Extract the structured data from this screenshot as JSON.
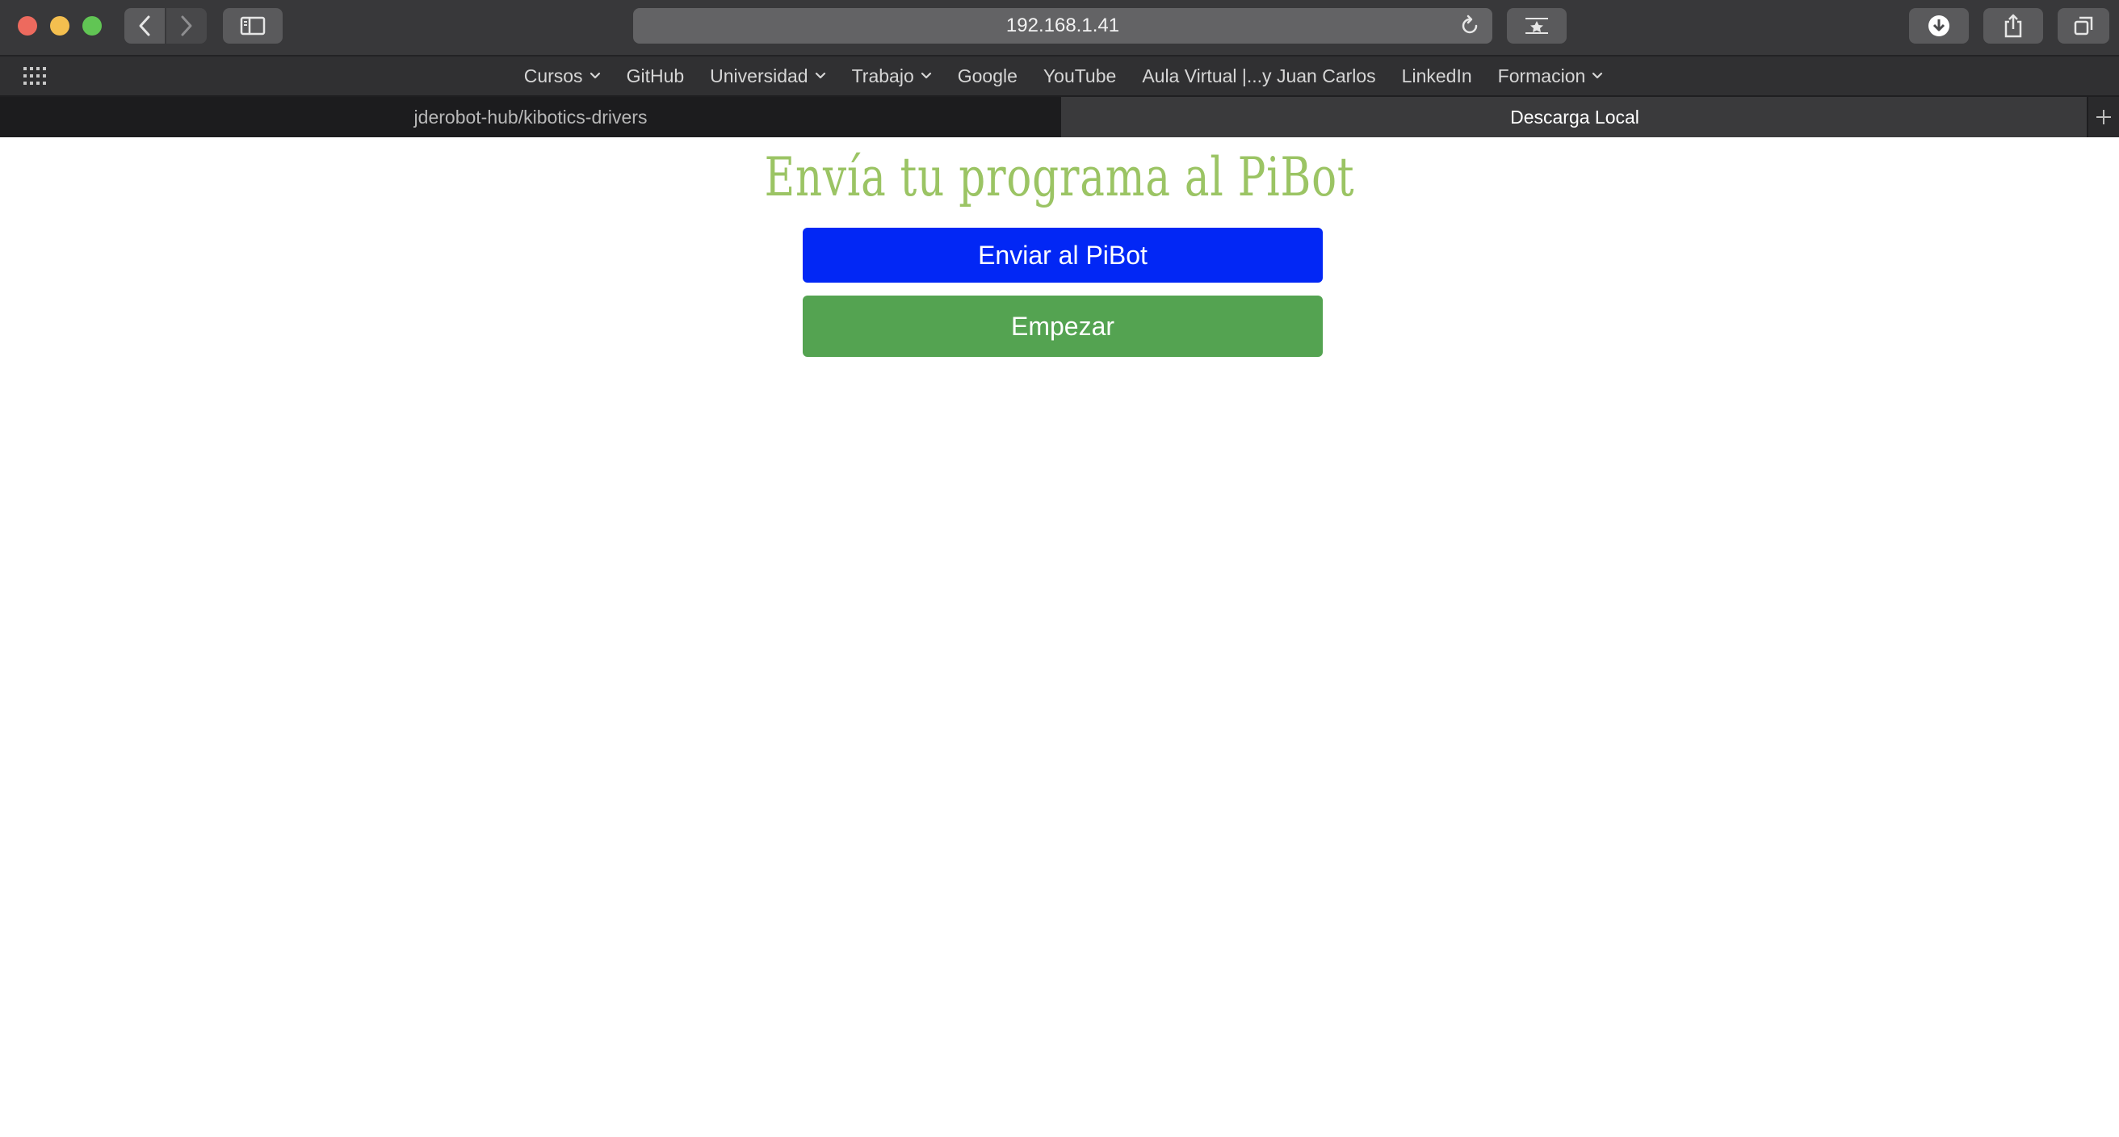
{
  "browser": {
    "address": "192.168.1.41",
    "favorites": [
      {
        "label": "Cursos",
        "dropdown": true
      },
      {
        "label": "GitHub",
        "dropdown": false
      },
      {
        "label": "Universidad",
        "dropdown": true
      },
      {
        "label": "Trabajo",
        "dropdown": true
      },
      {
        "label": "Google",
        "dropdown": false
      },
      {
        "label": "YouTube",
        "dropdown": false
      },
      {
        "label": "Aula Virtual |...y Juan Carlos",
        "dropdown": false
      },
      {
        "label": "LinkedIn",
        "dropdown": false
      },
      {
        "label": "Formacion",
        "dropdown": true
      }
    ],
    "tabs": [
      {
        "label": "jderobot-hub/kibotics-drivers",
        "active": false
      },
      {
        "label": "Descarga Local",
        "active": true
      }
    ],
    "icons": {
      "back": "chevron-left-icon",
      "forward": "chevron-right-icon",
      "sidebar": "sidebar-icon",
      "reload": "reload-icon",
      "reader": "reader-icon",
      "download": "download-icon",
      "share": "share-icon",
      "tabs": "tabs-overview-icon",
      "grid": "grid-icon",
      "new_tab": "plus-icon"
    }
  },
  "page": {
    "title": "Envía tu programa al PiBot",
    "send_button": "Enviar al PiBot",
    "start_button": "Empezar",
    "colors": {
      "title": "#9bc464",
      "send": "#0227f5",
      "start": "#54a351"
    }
  }
}
